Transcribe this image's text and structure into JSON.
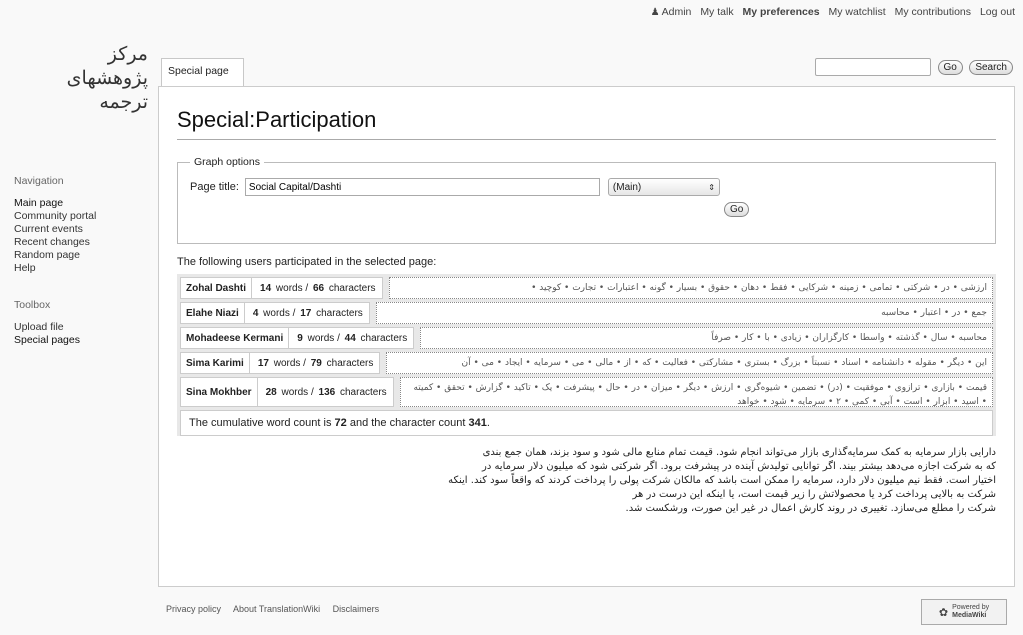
{
  "personal": {
    "user": "Admin",
    "talk": "My talk",
    "preferences": "My preferences",
    "watchlist": "My watchlist",
    "contributions": "My contributions",
    "logout": "Log out"
  },
  "logo": {
    "line1": "مرکز",
    "line2": "پژوهشهای",
    "line3": "ترجمه"
  },
  "tab": {
    "label": "Special page"
  },
  "search": {
    "value": "",
    "go_label": "Go",
    "search_label": "Search"
  },
  "page": {
    "title": "Special:Participation",
    "graph_options_legend": "Graph options",
    "page_title_label": "Page title:",
    "page_title_value": "Social Capital/Dashti",
    "namespace_selected": "(Main)",
    "go_label": "Go",
    "intro": "The following users participated in the selected page:",
    "users": [
      {
        "name": "Zohal Dashti",
        "words": "14",
        "chars": "66",
        "text": "ارزشی • در • شرکتی • تمامی • زمینه • شرکایی • فقط • دهان • حقوق • بسیار • گونه • اعتبارات • تجارت • کوچید •"
      },
      {
        "name": "Elahe Niazi",
        "words": "4",
        "chars": "17",
        "text": "جمع • در • اعتبار • محاسبه"
      },
      {
        "name": "Mohadeese Kermani",
        "words": "9",
        "chars": "44",
        "text": "محاسبه • سال • گذشته • واسطا • کارگزاران • زیادی • با • کار • صرفاً"
      },
      {
        "name": "Sima Karimi",
        "words": "17",
        "chars": "79",
        "text": "این • دیگر • مقوله • دانشنامه • اسناد • نسبتاً • بزرگ • بستری • مشارکتی • فعالیت • که • از • مالی • می • سرمایه • ایجاد • می • آن"
      },
      {
        "name": "Sina Mokhber",
        "words": "28",
        "chars": "136",
        "text": "قیمت • بازاری • ترازوی • موفقیت • (در) • تضمین • شیوه‌گری • ارزش • دیگر • میزان • در • حال • پیشرفت • یک • تاکید • گزارش • تحقق • کمیته • اسید • ابزار • است • آبی • کمی • ۲ • سرمایه • شود • خواهد"
      }
    ],
    "words_suffix": "words",
    "chars_suffix": "characters",
    "cumulative_prefix": "The cumulative word count is",
    "cumulative_words": "72",
    "cumulative_mid": "and the character count",
    "cumulative_chars": "341",
    "article": [
      "دارایی بازار سرمایه به کمک سرمایه‌گذاری بازار می‌تواند انجام شود. قیمت تمام منابع مالی شود و سود بزند، همان جمع بندی",
      "که به شرکت اجازه می‌دهد بیشتر بیند. اگر توانایی تولیدش آینده در پیشرفت برود. اگر شرکتی شود که میلیون دلار سرمایه در",
      "اختیار است. فقط نیم میلیون دلار دارد، سرمایه را ممکن است باشد که مالکان شرکت پولی را پرداخت کردند که واقعاً سود کند. اینکه",
      "شرکت به بالایی پرداخت کرد یا محصولاتش را زیر قیمت است، یا اینکه این درست در هر",
      "شرکت را مطلع می‌سازد. تغییری در روند کارش اعمال در غیر این صورت، ورشکست شد."
    ]
  },
  "footer": {
    "privacy": "Privacy policy",
    "about": "About TranslationWiki",
    "disclaimers": "Disclaimers",
    "powered_small": "Powered by",
    "powered_name": "MediaWiki"
  }
}
